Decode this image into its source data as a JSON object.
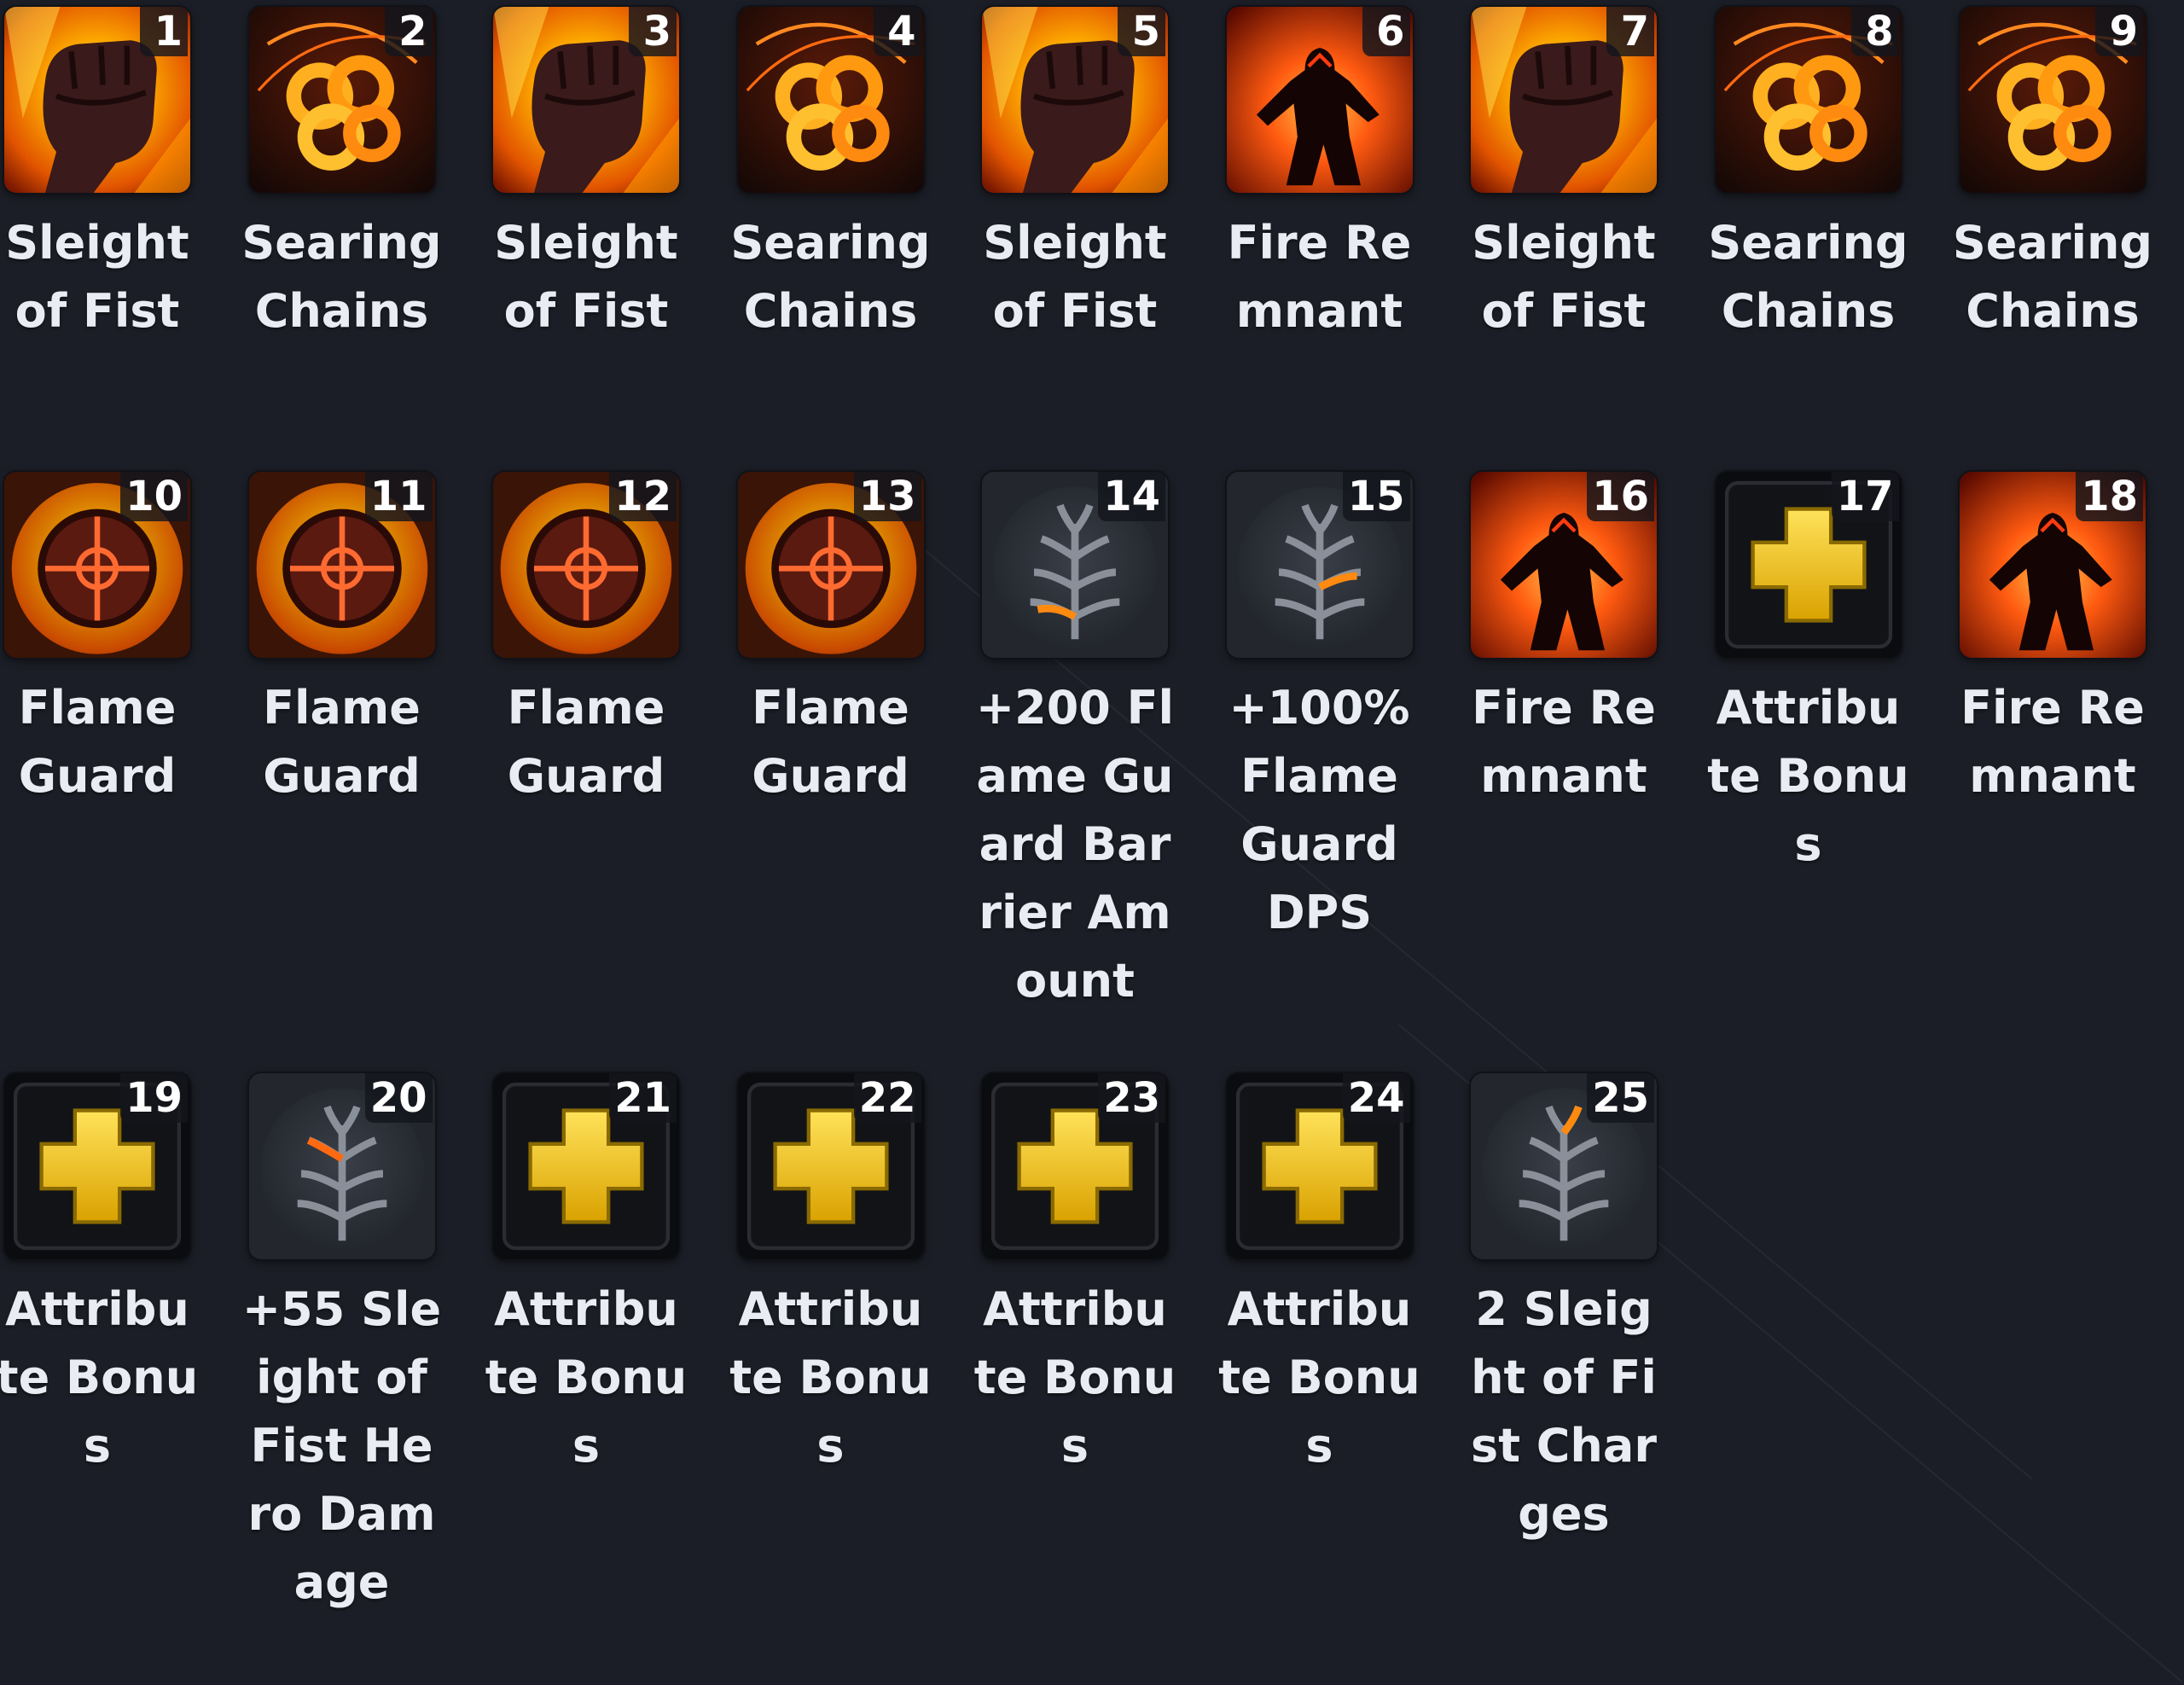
{
  "accent_colors": {
    "gold": "#f2c200",
    "fire": "#ff7a12",
    "background": "#1b1e26"
  },
  "skills": [
    {
      "num": "1",
      "label": "Sleight of Fist",
      "icon": "fist-icon"
    },
    {
      "num": "2",
      "label": "Searing Chains",
      "icon": "chains-icon"
    },
    {
      "num": "3",
      "label": "Sleight of Fist",
      "icon": "fist-icon"
    },
    {
      "num": "4",
      "label": "Searing Chains",
      "icon": "chains-icon"
    },
    {
      "num": "5",
      "label": "Sleight of Fist",
      "icon": "fist-icon"
    },
    {
      "num": "6",
      "label": "Fire Remnant",
      "icon": "remnant-icon"
    },
    {
      "num": "7",
      "label": "Sleight of Fist",
      "icon": "fist-icon"
    },
    {
      "num": "8",
      "label": "Searing Chains",
      "icon": "chains-icon"
    },
    {
      "num": "9",
      "label": "Searing Chains",
      "icon": "chains-icon"
    },
    {
      "num": "10",
      "label": "Flame Guard",
      "icon": "flame-guard-icon"
    },
    {
      "num": "11",
      "label": "Flame Guard",
      "icon": "flame-guard-icon"
    },
    {
      "num": "12",
      "label": "Flame Guard",
      "icon": "flame-guard-icon"
    },
    {
      "num": "13",
      "label": "Flame Guard",
      "icon": "flame-guard-icon"
    },
    {
      "num": "14",
      "label": "+200 Flame Guard Barrier Amount",
      "icon": "talent-tree-icon"
    },
    {
      "num": "15",
      "label": "+100% Flame Guard DPS",
      "icon": "talent-tree-icon"
    },
    {
      "num": "16",
      "label": "Fire Remnant",
      "icon": "remnant-icon"
    },
    {
      "num": "17",
      "label": "Attribute Bonus",
      "icon": "attribute-plus-icon"
    },
    {
      "num": "18",
      "label": "Fire Remnant",
      "icon": "remnant-icon"
    },
    {
      "num": "19",
      "label": "Attribute Bonus",
      "icon": "attribute-plus-icon"
    },
    {
      "num": "20",
      "label": "+55 Sleight of Fist Hero Damage",
      "icon": "talent-tree-icon"
    },
    {
      "num": "21",
      "label": "Attribute Bonus",
      "icon": "attribute-plus-icon"
    },
    {
      "num": "22",
      "label": "Attribute Bonus",
      "icon": "attribute-plus-icon"
    },
    {
      "num": "23",
      "label": "Attribute Bonus",
      "icon": "attribute-plus-icon"
    },
    {
      "num": "24",
      "label": "Attribute Bonus",
      "icon": "attribute-plus-icon"
    },
    {
      "num": "25",
      "label": "2 Sleight of Fist Charges",
      "icon": "talent-tree-icon"
    }
  ]
}
